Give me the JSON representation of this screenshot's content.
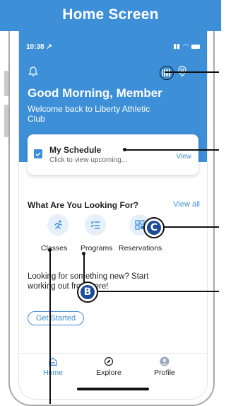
{
  "banner": {
    "title": "Home Screen"
  },
  "status": {
    "time": "10:38"
  },
  "hero": {
    "greeting_part1": "Good Morning, ",
    "greeting_part2": "Member",
    "welcome": "Welcome back to Liberty Athletic Club"
  },
  "schedule": {
    "title": "My Schedule",
    "subtitle": "Click to view upcoming...",
    "view_label": "View"
  },
  "looking": {
    "title": "What Are You Looking For?",
    "view_all": "View all",
    "categories": [
      {
        "label": "Classes",
        "icon": "running-icon"
      },
      {
        "label": "Programs",
        "icon": "list-icon"
      },
      {
        "label": "Reservations",
        "icon": "grid-icon"
      }
    ]
  },
  "promo": {
    "text": "Looking for something new? Start working out from here!",
    "button": "Get Started"
  },
  "bottom_nav": [
    {
      "label": "Home",
      "icon": "home-icon",
      "active": true
    },
    {
      "label": "Explore",
      "icon": "compass-icon",
      "active": false
    },
    {
      "label": "Profile",
      "icon": "avatar-icon",
      "active": false
    }
  ],
  "markers": {
    "b": "B",
    "c": "C"
  },
  "colors": {
    "accent": "#3d8fd8",
    "marker": "#1c4b97"
  }
}
